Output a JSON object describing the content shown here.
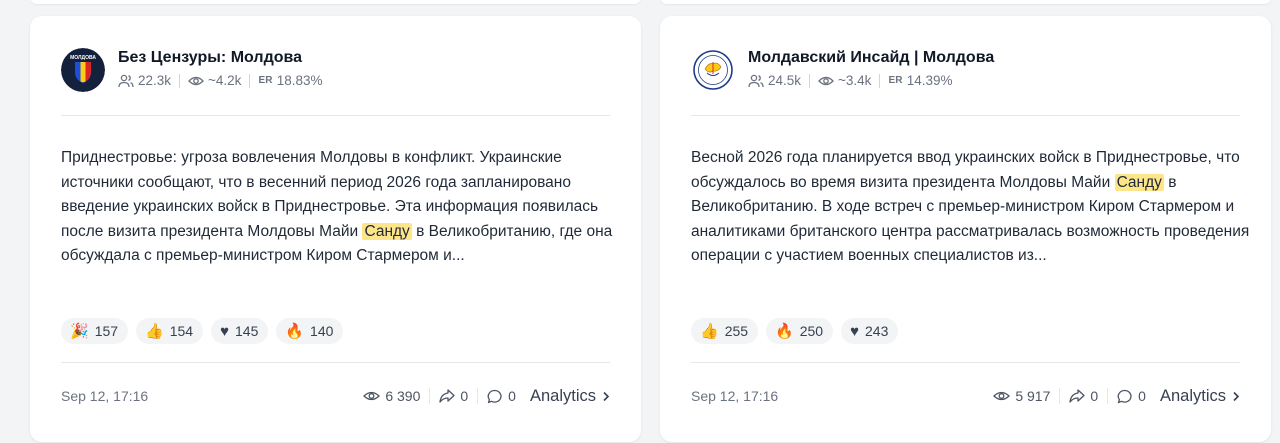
{
  "cards": [
    {
      "channel_name": "Без Цензуры: Молдова",
      "avatar_text": "МОЛДОВА",
      "subscribers": "22.3k",
      "views_avg": "~4.2k",
      "er_label": "ER",
      "er_value": "18.83%",
      "post": {
        "before": "Приднестровье: угроза вовлечения Молдовы в конфликт. Украинские источники сообщают, что в весенний период 2026 года запланировано введение украинских войск в Приднестровье. Эта информация появилась после визита президента Молдовы Майи ",
        "highlight": "Санду",
        "after": " в Великобританию, где она обсуждала с премьер-министром Киром Стармером и..."
      },
      "reactions": [
        {
          "emoji": "🎉",
          "count": "157"
        },
        {
          "emoji": "👍",
          "count": "154"
        },
        {
          "emoji": "♥",
          "count": "145"
        },
        {
          "emoji": "🔥",
          "count": "140"
        }
      ],
      "date": "Sep 12, 17:16",
      "views": "6 390",
      "shares": "0",
      "comments": "0",
      "analytics_label": "Analytics"
    },
    {
      "channel_name": "Молдавский Инсайд | Молдова",
      "subscribers": "24.5k",
      "views_avg": "~3.4k",
      "er_label": "ER",
      "er_value": "14.39%",
      "post": {
        "before": "Весной 2026 года планируется ввод украинских войск в Приднестровье, что обсуждалось во время визита президента Молдовы Майи ",
        "highlight": "Санду",
        "after": " в Великобританию. В ходе встреч с премьер-министром Киром Стармером и аналитиками британского центра рассматривалась возможность проведения операции с участием военных специалистов из..."
      },
      "reactions": [
        {
          "emoji": "👍",
          "count": "255"
        },
        {
          "emoji": "🔥",
          "count": "250"
        },
        {
          "emoji": "♥",
          "count": "243"
        }
      ],
      "date": "Sep 12, 17:16",
      "views": "5 917",
      "shares": "0",
      "comments": "0",
      "analytics_label": "Analytics"
    }
  ],
  "colors": {
    "highlight": "#fde68a",
    "text": "#1f2937",
    "muted": "#6b7280",
    "card_bg": "#ffffff",
    "page_bg": "#f3f4f6"
  }
}
